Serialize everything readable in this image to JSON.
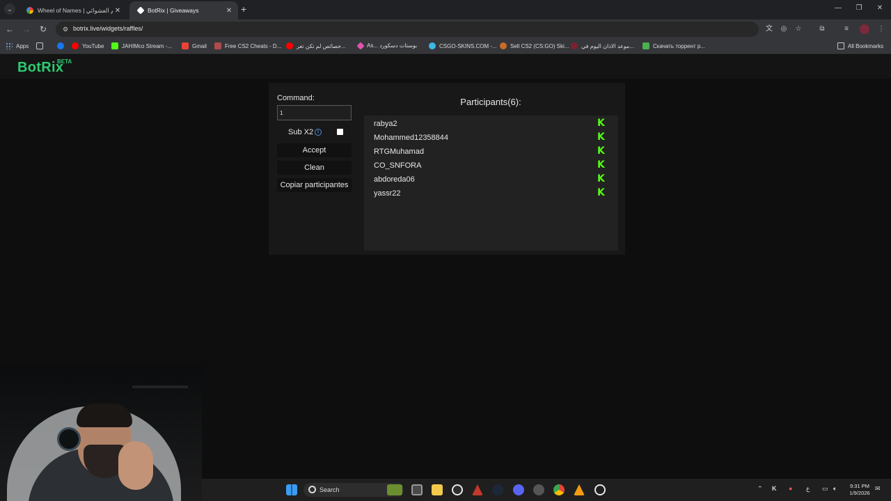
{
  "browser": {
    "tabs": [
      {
        "title": "Wheel of Names | اسم العشوائي",
        "favicon_color": "#e94235"
      },
      {
        "title": "BotRix | Giveaways",
        "favicon_color": "#ffffff"
      }
    ],
    "url": "botrix.live/widgets/raffles/",
    "new_tab": "+",
    "window_controls": {
      "minimize": "—",
      "maximize": "❐",
      "close": "✕"
    }
  },
  "bookmarks": {
    "items": [
      {
        "label": "Apps",
        "color": "#8ab4f8"
      },
      {
        "label": "",
        "color": "#8ab4f8"
      },
      {
        "label": "",
        "color": "#1877f2"
      },
      {
        "label": "YouTube",
        "color": "#ff0000"
      },
      {
        "label": "JAHIMco Stream -...",
        "color": "#53fc18"
      },
      {
        "label": "Gmail",
        "color": "#ea4335"
      },
      {
        "label": "Free CS2 Cheats - D...",
        "color": "#b14b4b"
      },
      {
        "label": "خصائص لم تكن تعر...",
        "color": "#ff0000"
      },
      {
        "label": "As... بوستات دسكورد",
        "color": "#e052b0"
      },
      {
        "label": "CSGO-SKINS.COM -...",
        "color": "#3db7e4"
      },
      {
        "label": "Sell CS2 (CS:GO) Ski...",
        "color": "#c86b2a"
      },
      {
        "label": "موعد الاذان اليوم في...",
        "color": "#7b2230"
      },
      {
        "label": "Скачать торрент р...",
        "color": "#4caf50"
      }
    ],
    "all_bookmarks": "All Bookmarks"
  },
  "site": {
    "logo": "BotRix",
    "logo_badge": "BETA",
    "brand_color": "#2ecc71"
  },
  "raffle": {
    "command_label": "Command:",
    "command_value": "1",
    "sub_x2_label": "Sub X2",
    "sub_x2_checked": false,
    "accept_label": "Accept",
    "clean_label": "Clean",
    "copy_label": "Copiar participantes",
    "participants_title": "Participants(6):",
    "participants": [
      {
        "name": "rabya2",
        "platform": "kick"
      },
      {
        "name": "Mohammed12358844",
        "platform": "kick"
      },
      {
        "name": "RTGMuhamad",
        "platform": "kick"
      },
      {
        "name": "CO_SNFORA",
        "platform": "kick"
      },
      {
        "name": "abdoreda06",
        "platform": "kick"
      },
      {
        "name": "yassr22",
        "platform": "kick"
      }
    ],
    "kick_glyph": "K",
    "kick_color": "#53fc18"
  },
  "taskbar": {
    "search_placeholder": "Search",
    "clock_time": "9:31 PM",
    "clock_date": "1/9/2026",
    "lang": "ع"
  }
}
